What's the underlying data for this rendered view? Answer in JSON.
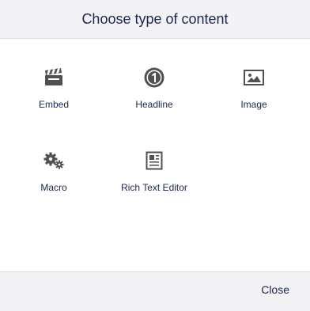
{
  "dialog": {
    "title": "Choose type of content",
    "close_label": "Close"
  },
  "items": [
    {
      "label": "Embed",
      "icon": "clapperboard-icon"
    },
    {
      "label": "Headline",
      "icon": "number-one-icon"
    },
    {
      "label": "Image",
      "icon": "image-icon"
    },
    {
      "label": "Macro",
      "icon": "gears-icon"
    },
    {
      "label": "Rich Text Editor",
      "icon": "document-icon"
    }
  ],
  "colors": {
    "text": "#1b264f",
    "icon": "#515151",
    "panel": "#f3f3f5"
  }
}
